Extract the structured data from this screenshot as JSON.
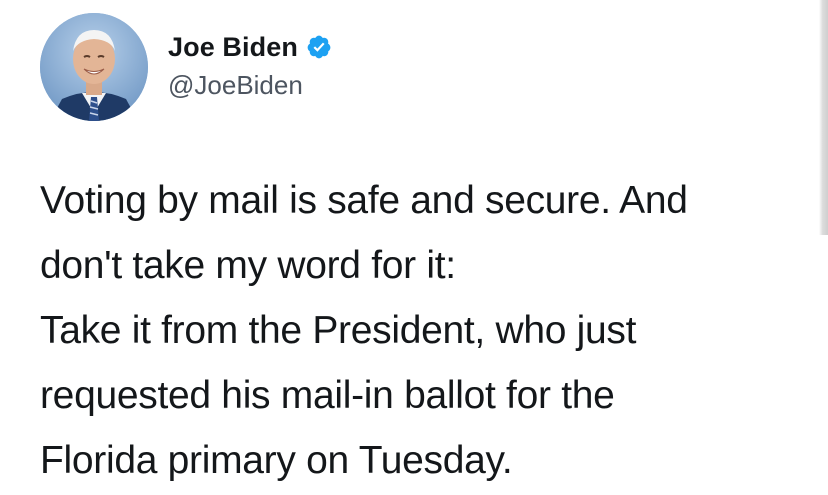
{
  "tweet": {
    "author": {
      "display_name": "Joe Biden",
      "handle": "@JoeBiden",
      "verified_icon": "verified-badge-icon",
      "avatar_icon": "profile-photo"
    },
    "lines": [
      "Voting by mail is safe and secure. And",
      "don't take my word for it:",
      "Take it from the President, who just",
      "requested his mail-in ballot for the",
      "Florida primary on Tuesday."
    ]
  },
  "colors": {
    "verified_blue": "#1da1f2",
    "text": "#14171a",
    "handle_gray": "#4d5560",
    "background": "#ffffff"
  }
}
